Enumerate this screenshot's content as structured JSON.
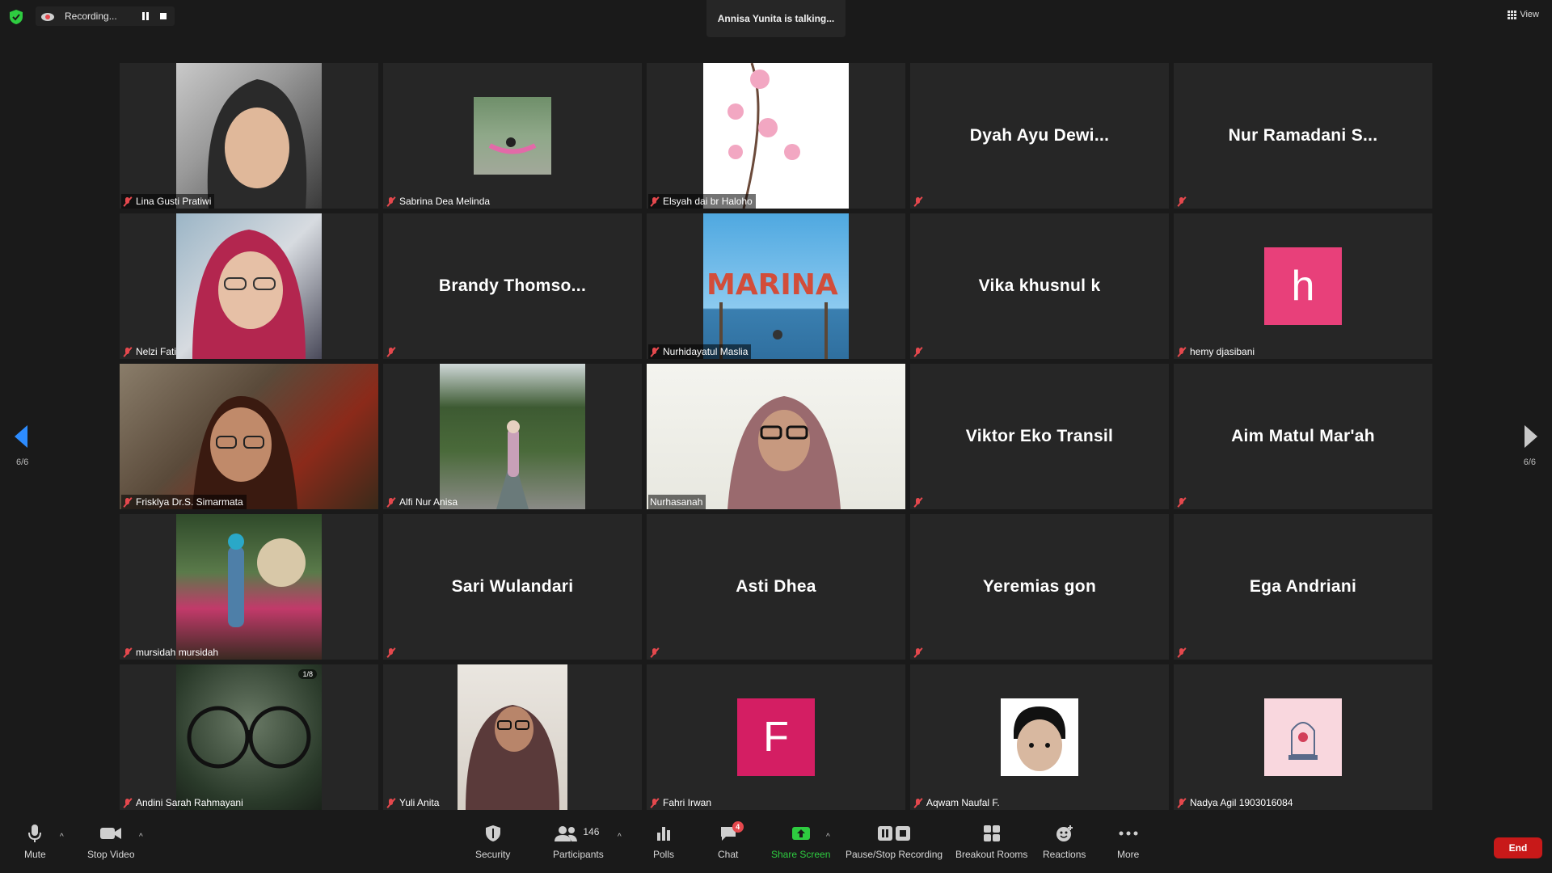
{
  "top": {
    "recording_label": "Recording...",
    "talking": "Annisa Yunita is talking...",
    "view_label": "View"
  },
  "pagination": {
    "left": "6/6",
    "right": "6/6"
  },
  "tiles": [
    {
      "name": "Lina Gusti Pratiwi",
      "video": true
    },
    {
      "name": "Sabrina Dea Melinda",
      "video": true
    },
    {
      "name": "Elsyah dai br Haloho",
      "video": true
    },
    {
      "name": "Dyah Ayu Dewi...",
      "video": false
    },
    {
      "name": "Nur Ramadani S...",
      "video": false
    },
    {
      "name": "Nelzi Fati",
      "video": true
    },
    {
      "name": "Brandy  Thomso...",
      "video": false
    },
    {
      "name": "Nurhidayatul Maslia",
      "video": true
    },
    {
      "name": "Vika khusnul k",
      "video": false
    },
    {
      "name": "hemy djasibani",
      "video": true,
      "avatar_letter": "h"
    },
    {
      "name": "Frisklya Dr.S. Simarmata",
      "video": true
    },
    {
      "name": "Alfi Nur Anisa",
      "video": true
    },
    {
      "name": "Nurhasanah",
      "video": true
    },
    {
      "name": "Viktor Eko Transil",
      "video": false
    },
    {
      "name": "Aim Matul Mar'ah",
      "video": false
    },
    {
      "name": "mursidah mursidah",
      "video": true
    },
    {
      "name": "Sari Wulandari",
      "video": false
    },
    {
      "name": "Asti Dhea",
      "video": false
    },
    {
      "name": "Yeremias gon",
      "video": false
    },
    {
      "name": "Ega Andriani",
      "video": false
    },
    {
      "name": "Andini Sarah Rahmayani",
      "video": true,
      "badge": "1/8"
    },
    {
      "name": "Yuli Anita",
      "video": true
    },
    {
      "name": "Fahri Irwan",
      "video": true,
      "avatar_letter": "F"
    },
    {
      "name": "Aqwam Naufal F.",
      "video": true
    },
    {
      "name": "Nadya Agil 1903016084",
      "video": true
    }
  ],
  "toolbar": {
    "mute": "Mute",
    "stop_video": "Stop Video",
    "security": "Security",
    "participants": "Participants",
    "participants_count": "146",
    "polls": "Polls",
    "chat": "Chat",
    "chat_badge": "4",
    "share_screen": "Share Screen",
    "pause_recording": "Pause/Stop Recording",
    "breakout_rooms": "Breakout Rooms",
    "reactions": "Reactions",
    "more": "More",
    "end": "End"
  },
  "colors": {
    "accent_blue": "#2d8cff",
    "end_red": "#c81919",
    "mute_red": "#e5484d",
    "share_green": "#2ecc40",
    "avatar_pink": "#e8407a",
    "avatar_magenta": "#d41e63"
  }
}
